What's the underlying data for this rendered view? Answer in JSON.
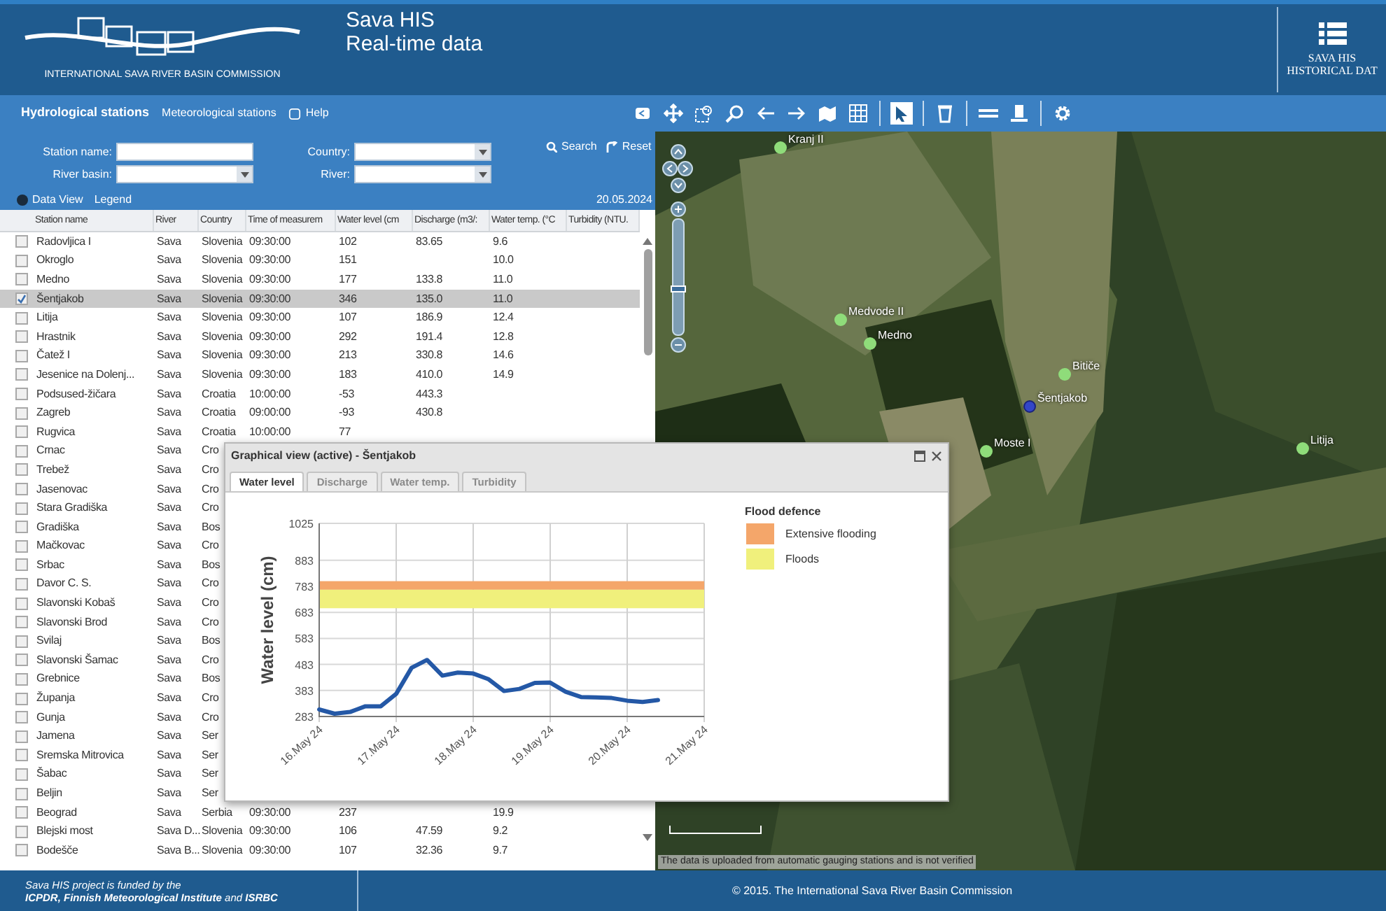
{
  "header": {
    "logo_caption": "INTERNATIONAL SAVA RIVER BASIN COMMISSION",
    "title": "Sava HIS",
    "subtitle": "Real-time data",
    "historical_button": [
      "SAVA HIS",
      "HISTORICAL DAT"
    ]
  },
  "nav": {
    "tabs": [
      {
        "label": "Hydrological stations",
        "selected": true
      },
      {
        "label": "Meteorological stations",
        "selected": false
      }
    ],
    "help": "Help"
  },
  "toolbar": {
    "tools": [
      {
        "kind": "collapse",
        "selected": false
      },
      {
        "kind": "pan",
        "selected": false
      },
      {
        "kind": "zoombox",
        "selected": false
      },
      {
        "kind": "zoomout",
        "selected": false
      },
      {
        "kind": "back",
        "selected": false
      },
      {
        "kind": "forward",
        "selected": false
      },
      {
        "kind": "layers",
        "selected": false
      },
      {
        "kind": "grid",
        "selected": false
      },
      {
        "kind": "select",
        "selected": true
      },
      {
        "kind": "clear",
        "selected": false
      },
      {
        "kind": "measure",
        "selected": false
      },
      {
        "kind": "print",
        "selected": false
      },
      {
        "kind": "settings",
        "selected": false
      }
    ]
  },
  "search_form": {
    "fields": [
      {
        "label": "Station name:",
        "kind": "text"
      },
      {
        "label": "Country:",
        "kind": "select"
      },
      {
        "label": "River basin:",
        "kind": "select"
      },
      {
        "label": "River:",
        "kind": "select"
      }
    ],
    "buttons": [
      {
        "kind": "search",
        "label": "Search"
      },
      {
        "kind": "reset",
        "label": "Reset"
      }
    ]
  },
  "data_bar": {
    "links": [
      "Data View",
      "Legend"
    ],
    "date": "20.05.2024"
  },
  "table": {
    "columns": [
      "Station name",
      "River",
      "Country",
      "Time of measurem",
      "Water level (cm",
      "Discharge (m3/:",
      "Water temp. (°C",
      "Turbidity (NTU."
    ],
    "rows": [
      {
        "checked": false,
        "selected": false,
        "cells": [
          "Radovljica I",
          "Sava",
          "Slovenia",
          "09:30:00",
          "102",
          "83.65",
          "9.6"
        ]
      },
      {
        "checked": false,
        "selected": false,
        "cells": [
          "Okroglo",
          "Sava",
          "Slovenia",
          "09:30:00",
          "151",
          "",
          "10.0"
        ]
      },
      {
        "checked": false,
        "selected": false,
        "cells": [
          "Medno",
          "Sava",
          "Slovenia",
          "09:30:00",
          "177",
          "133.8",
          "11.0"
        ]
      },
      {
        "checked": true,
        "selected": true,
        "cells": [
          "Šentjakob",
          "Sava",
          "Slovenia",
          "09:30:00",
          "346",
          "135.0",
          "11.0"
        ]
      },
      {
        "checked": false,
        "selected": false,
        "cells": [
          "Litija",
          "Sava",
          "Slovenia",
          "09:30:00",
          "107",
          "186.9",
          "12.4"
        ]
      },
      {
        "checked": false,
        "selected": false,
        "cells": [
          "Hrastnik",
          "Sava",
          "Slovenia",
          "09:30:00",
          "292",
          "191.4",
          "12.8"
        ]
      },
      {
        "checked": false,
        "selected": false,
        "cells": [
          "Čatež I",
          "Sava",
          "Slovenia",
          "09:30:00",
          "213",
          "330.8",
          "14.6"
        ]
      },
      {
        "checked": false,
        "selected": false,
        "cells": [
          "Jesenice na Dolenj...",
          "Sava",
          "Slovenia",
          "09:30:00",
          "183",
          "410.0",
          "14.9"
        ]
      },
      {
        "checked": false,
        "selected": false,
        "cells": [
          "Podsused-žičara",
          "Sava",
          "Croatia",
          "10:00:00",
          "-53",
          "443.3"
        ]
      },
      {
        "checked": false,
        "selected": false,
        "cells": [
          "Zagreb",
          "Sava",
          "Croatia",
          "09:00:00",
          "-93",
          "430.8"
        ]
      },
      {
        "checked": false,
        "selected": false,
        "cells": [
          "Rugvica",
          "Sava",
          "Croatia",
          "10:00:00",
          "77"
        ]
      },
      {
        "checked": false,
        "selected": false,
        "cells": [
          "Crnac",
          "Sava",
          "Cro"
        ]
      },
      {
        "checked": false,
        "selected": false,
        "cells": [
          "Trebež",
          "Sava",
          "Cro"
        ]
      },
      {
        "checked": false,
        "selected": false,
        "cells": [
          "Jasenovac",
          "Sava",
          "Cro"
        ]
      },
      {
        "checked": false,
        "selected": false,
        "cells": [
          "Stara Gradiška",
          "Sava",
          "Cro"
        ]
      },
      {
        "checked": false,
        "selected": false,
        "cells": [
          "Gradiška",
          "Sava",
          "Bos"
        ]
      },
      {
        "checked": false,
        "selected": false,
        "cells": [
          "Mačkovac",
          "Sava",
          "Cro"
        ]
      },
      {
        "checked": false,
        "selected": false,
        "cells": [
          "Srbac",
          "Sava",
          "Bos"
        ]
      },
      {
        "checked": false,
        "selected": false,
        "cells": [
          "Davor C. S.",
          "Sava",
          "Cro"
        ]
      },
      {
        "checked": false,
        "selected": false,
        "cells": [
          "Slavonski Kobaš",
          "Sava",
          "Cro"
        ]
      },
      {
        "checked": false,
        "selected": false,
        "cells": [
          "Slavonski Brod",
          "Sava",
          "Cro"
        ]
      },
      {
        "checked": false,
        "selected": false,
        "cells": [
          "Svilaj",
          "Sava",
          "Bos"
        ]
      },
      {
        "checked": false,
        "selected": false,
        "cells": [
          "Slavonski Šamac",
          "Sava",
          "Cro"
        ]
      },
      {
        "checked": false,
        "selected": false,
        "cells": [
          "Grebnice",
          "Sava",
          "Bos"
        ]
      },
      {
        "checked": false,
        "selected": false,
        "cells": [
          "Županja",
          "Sava",
          "Cro"
        ]
      },
      {
        "checked": false,
        "selected": false,
        "cells": [
          "Gunja",
          "Sava",
          "Cro"
        ]
      },
      {
        "checked": false,
        "selected": false,
        "cells": [
          "Jamena",
          "Sava",
          "Ser"
        ]
      },
      {
        "checked": false,
        "selected": false,
        "cells": [
          "Sremska Mitrovica",
          "Sava",
          "Ser"
        ]
      },
      {
        "checked": false,
        "selected": false,
        "cells": [
          "Šabac",
          "Sava",
          "Ser"
        ]
      },
      {
        "checked": false,
        "selected": false,
        "cells": [
          "Beljin",
          "Sava",
          "Ser"
        ]
      },
      {
        "checked": false,
        "selected": false,
        "cells": [
          "Beograd",
          "Sava",
          "Serbia",
          "09:30:00",
          "237",
          "",
          "19.9"
        ]
      },
      {
        "checked": false,
        "selected": false,
        "cells": [
          "Blejski most",
          "Sava D...",
          "Slovenia",
          "09:30:00",
          "106",
          "47.59",
          "9.2"
        ]
      },
      {
        "checked": false,
        "selected": false,
        "cells": [
          "Bodešče",
          "Sava B...",
          "Slovenia",
          "09:30:00",
          "107",
          "32.36",
          "9.7"
        ]
      }
    ]
  },
  "graph_window": {
    "title": "Graphical view (active) - Šentjakob",
    "tabs": [
      {
        "label": "Water level",
        "selected": true
      },
      {
        "label": "Discharge",
        "selected": false
      },
      {
        "label": "Water temp.",
        "selected": false
      },
      {
        "label": "Turbidity",
        "selected": false
      }
    ],
    "legend": {
      "title": "Flood defence",
      "items": [
        {
          "label": "Extensive flooding",
          "color": "#f4a66a"
        },
        {
          "label": "Floods",
          "color": "#f0f07c"
        }
      ]
    },
    "chart_data": {
      "type": "line",
      "ylabel": "Water level (cm)",
      "ylim": [
        283,
        1025
      ],
      "grid": true,
      "categories": [
        "16.May 24",
        null,
        null,
        null,
        null,
        "17.May 24",
        null,
        null,
        null,
        null,
        "18.May 24",
        null,
        null,
        null,
        null,
        "19.May 24",
        null,
        null,
        null,
        null,
        "20.May 24",
        null,
        null,
        null,
        null,
        "21.May 24"
      ],
      "series": [
        {
          "color": "#2458a6",
          "values": [
            310,
            294,
            300,
            322,
            322,
            370,
            470,
            500,
            440,
            452,
            448,
            426,
            381,
            389,
            412,
            413,
            378,
            358,
            356,
            354,
            344,
            339,
            346,
            null,
            null,
            null
          ]
        }
      ],
      "yticks": [
        283,
        383,
        483,
        583,
        683,
        783,
        883,
        1025
      ],
      "bands": [
        {
          "axis": "y",
          "from": 770,
          "to": 803,
          "color": "#f4a66a"
        },
        {
          "axis": "y",
          "from": 699,
          "to": 770,
          "color": "#f0f07c"
        }
      ]
    }
  },
  "map": {
    "zoom": {
      "level": 0.4
    },
    "stations": [
      {
        "label": "Kranj II",
        "selected": false
      },
      {
        "label": "Medvode II",
        "selected": false
      },
      {
        "label": "Medno",
        "selected": false
      },
      {
        "label": "Bitiče",
        "selected": false
      },
      {
        "label": "Šentjakob",
        "selected": true
      },
      {
        "label": "Moste I",
        "selected": false
      },
      {
        "label": "Litija",
        "selected": false
      }
    ],
    "notice": "The data is uploaded from automatic gauging stations and is not verified"
  },
  "footer": {
    "funding": [
      "Sava HIS project is funded by the",
      "**ICPDR, Finnish Meteorological Institute** and **ISRBC**"
    ],
    "copyright": "© 2015. The International Sava River Basin Commission"
  }
}
